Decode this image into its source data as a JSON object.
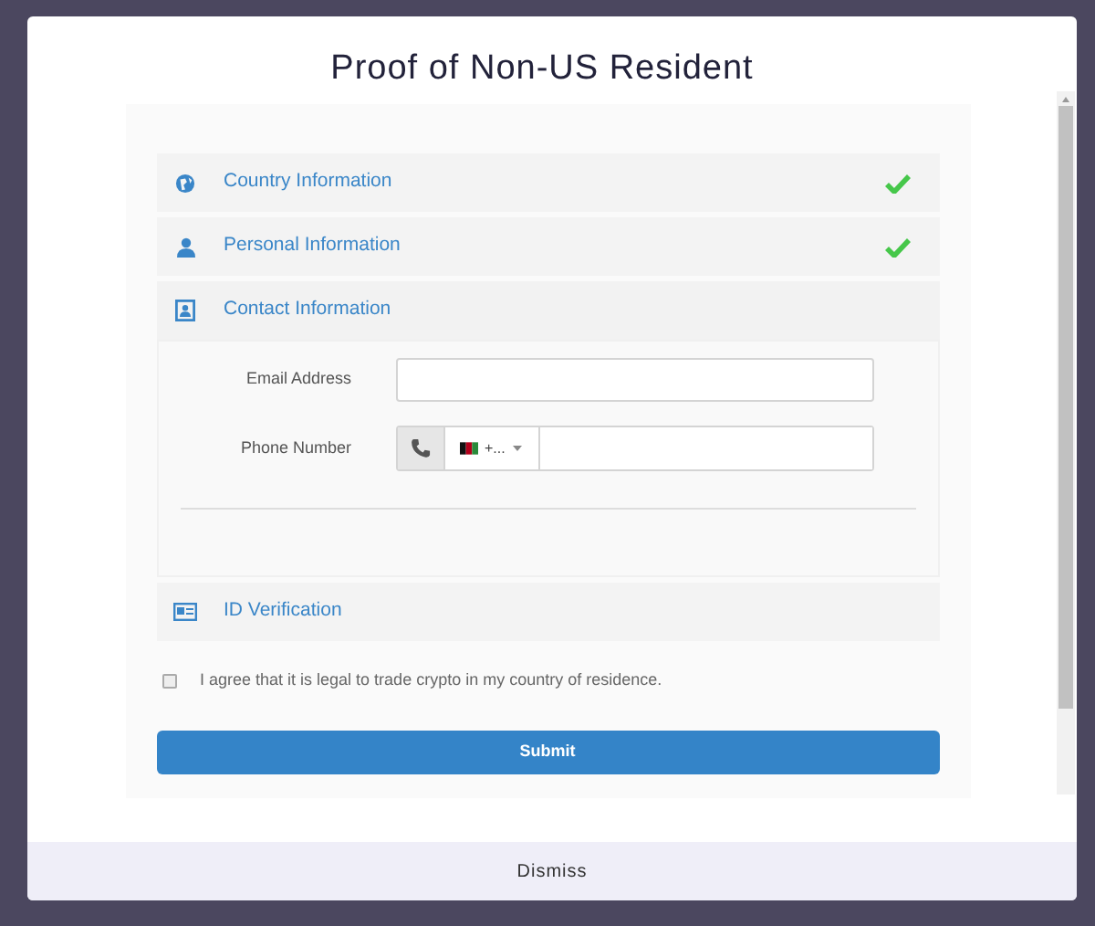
{
  "dialog": {
    "title": "Proof of Non-US Resident"
  },
  "sections": [
    {
      "kind": "globe",
      "title": "Country Information",
      "completed": true,
      "expanded": false
    },
    {
      "kind": "user",
      "title": "Personal Information",
      "completed": true,
      "expanded": false
    },
    {
      "kind": "contact",
      "title": "Contact Information",
      "completed": false,
      "expanded": true,
      "fields": [
        {
          "kind": "text",
          "label": "Email Address"
        },
        {
          "kind": "phone",
          "label": "Phone Number",
          "dial_code": "+..."
        }
      ]
    },
    {
      "kind": "id",
      "title": "ID Verification",
      "completed": false,
      "expanded": false
    }
  ],
  "agreement": {
    "label": "I agree that it is legal to trade crypto in my country of residence.",
    "checked": false
  },
  "submit": "Submit",
  "dismiss": "Dismiss"
}
